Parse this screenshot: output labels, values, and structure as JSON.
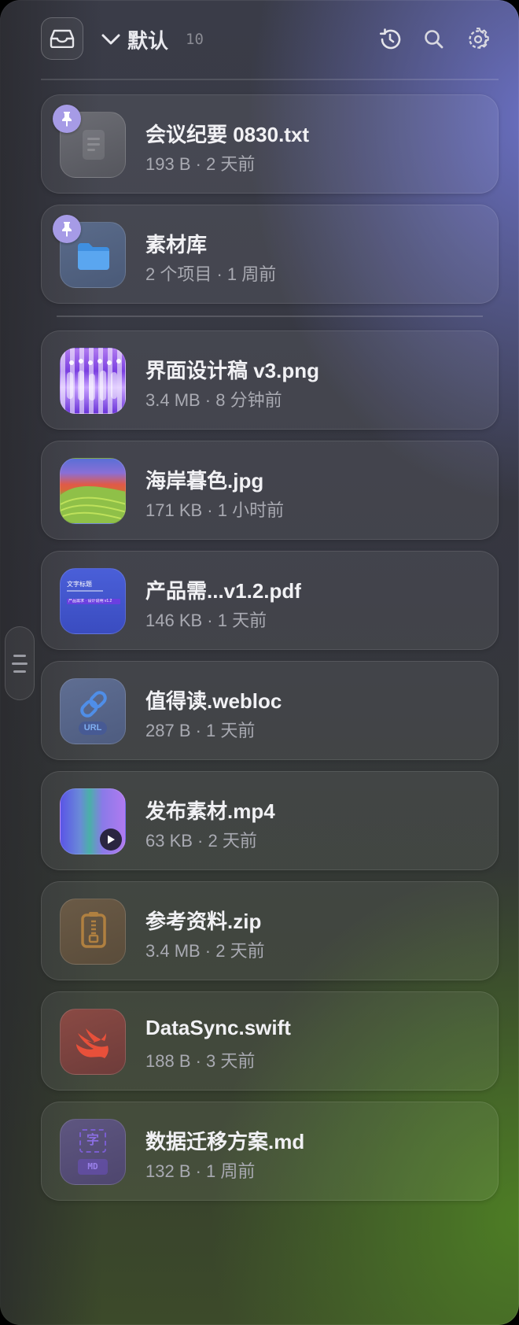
{
  "header": {
    "group_name": "默认",
    "group_count": "10",
    "icons": [
      "inbox-icon",
      "chevron-down-icon",
      "history-icon",
      "search-icon",
      "gear-icon"
    ]
  },
  "items": [
    {
      "name": "会议纪要 0830.txt",
      "meta": "193 B · 2 天前",
      "pinned": true,
      "icon": "text-file-icon"
    },
    {
      "name": "素材库",
      "meta": "2 个项目 · 1 周前",
      "pinned": true,
      "icon": "folder-icon"
    },
    {
      "name": "界面设计稿 v3.png",
      "meta": "3.4 MB · 8 分钟前",
      "pinned": false,
      "icon": "image-thumbnail"
    },
    {
      "name": "海岸暮色.jpg",
      "meta": "171 KB · 1 小时前",
      "pinned": false,
      "icon": "image-thumbnail"
    },
    {
      "name": "产品需...v1.2.pdf",
      "meta": "146 KB · 1 天前",
      "pinned": false,
      "icon": "pdf-thumbnail",
      "thumb_title": "文字标题",
      "thumb_line": "产品需求 · 设计说明 v1.2"
    },
    {
      "name": "值得读.webloc",
      "meta": "287 B · 1 天前",
      "pinned": false,
      "icon": "link-icon",
      "thumb_label": "URL"
    },
    {
      "name": "发布素材.mp4",
      "meta": "63 KB · 2 天前",
      "pinned": false,
      "icon": "play-icon"
    },
    {
      "name": "参考资料.zip",
      "meta": "3.4 MB · 2 天前",
      "pinned": false,
      "icon": "zip-icon"
    },
    {
      "name": "DataSync.swift",
      "meta": "188 B · 3 天前",
      "pinned": false,
      "icon": "swift-icon"
    },
    {
      "name": "数据迁移方案.md",
      "meta": "132 B · 1 周前",
      "pinned": false,
      "icon": "markdown-icon",
      "thumb_glyph": "字",
      "thumb_label": "MD"
    }
  ],
  "colors": {
    "pin": "#a69be6",
    "accent_top": "#6c72c8",
    "accent_bottom": "#4e8024"
  }
}
